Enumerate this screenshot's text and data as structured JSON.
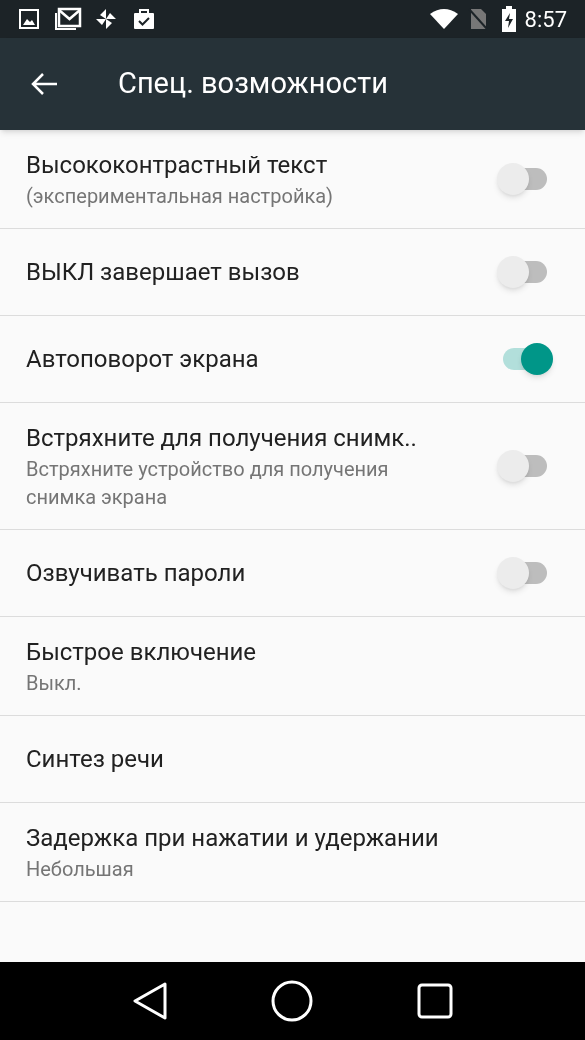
{
  "status_bar": {
    "time": "8:57"
  },
  "toolbar": {
    "title": "Спец. возможности"
  },
  "settings": [
    {
      "kind": "switch",
      "title": "Высококонтрастный текст",
      "summary": "(экспериментальная настройка)",
      "on": false
    },
    {
      "kind": "switch",
      "title": "ВЫКЛ завершает вызов",
      "on": false
    },
    {
      "kind": "switch",
      "title": "Автоповорот экрана",
      "on": true
    },
    {
      "kind": "switch",
      "title": "Встряхните для получения снимк..",
      "summary": "Встряхните устройство для получения снимка экрана",
      "on": false
    },
    {
      "kind": "switch",
      "title": "Озвучивать пароли",
      "on": false
    },
    {
      "kind": "plain",
      "title": "Быстрое включение",
      "summary": "Выкл."
    },
    {
      "kind": "plain",
      "title": "Синтез речи"
    },
    {
      "kind": "plain",
      "title": "Задержка при нажатии и удержании",
      "summary": "Небольшая"
    }
  ]
}
